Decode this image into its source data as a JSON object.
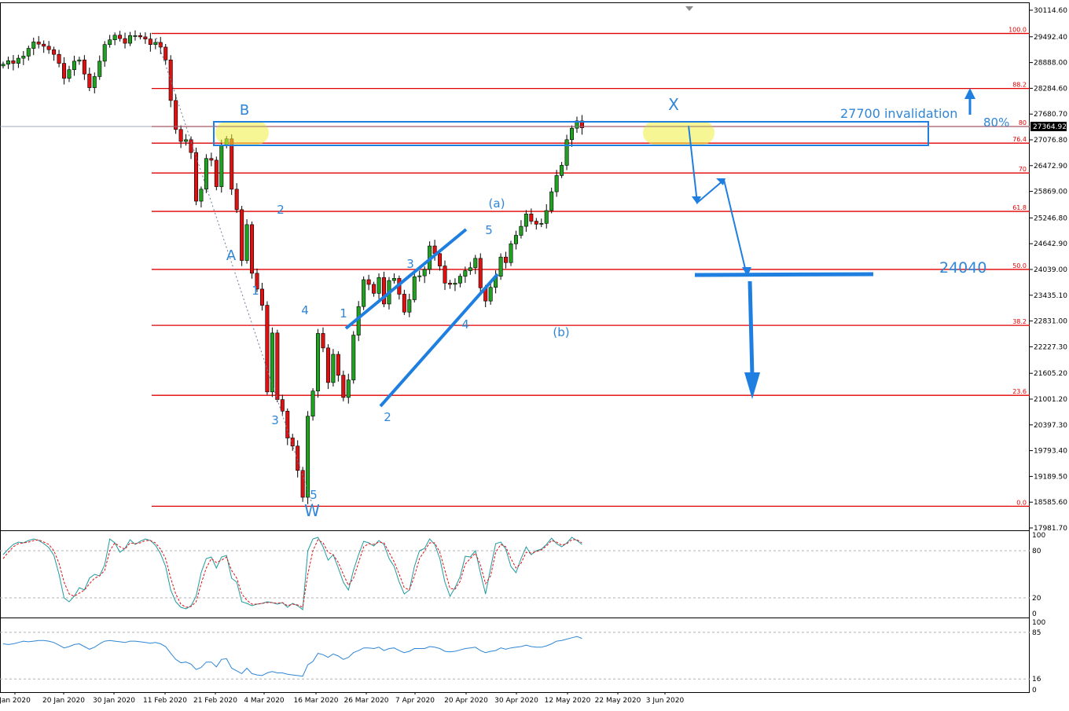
{
  "chart_data": [
    {
      "type": "candlestick",
      "title": "",
      "x_tick_labels": [
        "Jan 2020",
        "20 Jan 2020",
        "30 Jan 2020",
        "11 Feb 2020",
        "21 Feb 2020",
        "4 Mar 2020",
        "16 Mar 2020",
        "26 Mar 2020",
        "7 Apr 2020",
        "20 Apr 2020",
        "30 Apr 2020",
        "12 May 2020",
        "22 May 2020",
        "3 Jun 2020"
      ],
      "y_tick_labels": [
        "30114.60",
        "29492.40",
        "28888.00",
        "28284.60",
        "27680.70",
        "27076.80",
        "26472.90",
        "25869.00",
        "25246.80",
        "24642.90",
        "24039.00",
        "23435.10",
        "22831.00",
        "22227.30",
        "21605.20",
        "21001.20",
        "20397.30",
        "19793.40",
        "19189.50",
        "18585.60",
        "17981.70"
      ],
      "ylim": [
        17981.7,
        30114.6
      ],
      "current_price": "27364.92",
      "closes": [
        28850,
        28930,
        28870,
        28990,
        29040,
        29220,
        29370,
        29320,
        29270,
        29190,
        29080,
        28870,
        28520,
        28720,
        28920,
        28950,
        28620,
        28300,
        28560,
        28920,
        29310,
        29420,
        29530,
        29450,
        29340,
        29520,
        29520,
        29490,
        29440,
        29310,
        29360,
        29250,
        28950,
        28000,
        27320,
        27040,
        27080,
        26780,
        25640,
        25920,
        26640,
        26600,
        25980,
        26960,
        27100,
        25920,
        25440,
        24250,
        25090,
        23950,
        23580,
        23200,
        21170,
        22550,
        20990,
        20720,
        20090,
        19900,
        19330,
        18700,
        20600,
        21190,
        22540,
        22200,
        21390,
        22050,
        21560,
        21040,
        21450,
        22500,
        23170,
        23800,
        23690,
        23480,
        23850,
        23230,
        23780,
        23830,
        23460,
        23040,
        23330,
        23870,
        23890,
        24040,
        24590,
        24410,
        24120,
        23720,
        23690,
        23720,
        23880,
        24010,
        24080,
        24300,
        23610,
        23300,
        23620,
        23880,
        24330,
        24200,
        24640,
        24840,
        25050,
        25340,
        25170,
        25100,
        25120,
        25420,
        25860,
        26240,
        26480,
        27080,
        27350,
        27520,
        27360
      ],
      "fibonacci_levels": [
        {
          "label": "100.0",
          "value": 29570
        },
        {
          "label": "88.2",
          "value": 28280
        },
        {
          "label": "80",
          "value": 27390
        },
        {
          "label": "76.4",
          "value": 27000
        },
        {
          "label": "70",
          "value": 26300
        },
        {
          "label": "61.8",
          "value": 25400
        },
        {
          "label": "50.0",
          "value": 24040
        },
        {
          "label": "38.2",
          "value": 22730
        },
        {
          "label": "23.6",
          "value": 21090
        },
        {
          "label": "0.0",
          "value": 18490
        }
      ],
      "annotations": [
        {
          "label": "B"
        },
        {
          "label": "A"
        },
        {
          "label": "1"
        },
        {
          "label": "2"
        },
        {
          "label": "3"
        },
        {
          "label": "4"
        },
        {
          "label": "5"
        },
        {
          "label": "W"
        },
        {
          "label": "1"
        },
        {
          "label": "2"
        },
        {
          "label": "3"
        },
        {
          "label": "4"
        },
        {
          "label": "5"
        },
        {
          "label": "(a)"
        },
        {
          "label": "(b)"
        },
        {
          "label": "X"
        }
      ],
      "invalidation_text": "27700 invalidation",
      "target_text": "24040",
      "pct_text": "80%"
    },
    {
      "type": "line",
      "title": "",
      "y_tick_labels": [
        "100",
        "80",
        "20",
        "0"
      ],
      "ylim": [
        0,
        100
      ],
      "reference_levels": [
        80,
        20
      ],
      "series": [
        {
          "values": [
            75,
            82,
            88,
            91,
            90,
            93,
            95,
            93,
            89,
            84,
            74,
            50,
            20,
            15,
            22,
            33,
            30,
            45,
            50,
            48,
            62,
            95,
            90,
            78,
            83,
            94,
            88,
            92,
            95,
            93,
            87,
            76,
            60,
            30,
            15,
            8,
            6,
            10,
            22,
            52,
            70,
            72,
            58,
            72,
            74,
            45,
            40,
            15,
            13,
            10,
            12,
            13,
            15,
            14,
            12,
            14,
            8,
            13,
            10,
            5,
            80,
            95,
            97,
            85,
            68,
            75,
            58,
            40,
            30,
            55,
            75,
            92,
            90,
            86,
            93,
            88,
            70,
            60,
            40,
            25,
            30,
            60,
            80,
            83,
            95,
            88,
            70,
            40,
            22,
            33,
            47,
            73,
            72,
            80,
            52,
            25,
            58,
            89,
            91,
            82,
            60,
            52,
            70,
            85,
            75,
            80,
            82,
            88,
            96,
            89,
            85,
            90,
            97,
            93,
            88
          ]
        },
        {
          "values": [
            70,
            78,
            85,
            89,
            90,
            91,
            93,
            94,
            91,
            88,
            80,
            64,
            40,
            25,
            22,
            26,
            30,
            38,
            45,
            48,
            55,
            80,
            90,
            85,
            82,
            90,
            89,
            90,
            93,
            93,
            90,
            82,
            70,
            45,
            25,
            12,
            8,
            9,
            15,
            38,
            58,
            70,
            65,
            68,
            72,
            55,
            45,
            25,
            17,
            12,
            12,
            13,
            14,
            14,
            13,
            14,
            10,
            12,
            11,
            8,
            50,
            80,
            94,
            90,
            78,
            75,
            65,
            50,
            36,
            45,
            65,
            85,
            89,
            88,
            91,
            90,
            78,
            66,
            50,
            33,
            30,
            48,
            70,
            80,
            90,
            90,
            78,
            55,
            32,
            31,
            41,
            63,
            70,
            77,
            62,
            38,
            48,
            78,
            88,
            85,
            70,
            58,
            64,
            78,
            77,
            79,
            81,
            86,
            93,
            91,
            87,
            89,
            94,
            94,
            90
          ]
        }
      ]
    },
    {
      "type": "line",
      "title": "",
      "y_tick_labels": [
        "100",
        "85",
        "16",
        "0"
      ],
      "ylim": [
        0,
        100
      ],
      "reference_levels": [
        85,
        16
      ],
      "series": [
        {
          "values": [
            68,
            67,
            68,
            70,
            72,
            71,
            72,
            73,
            73,
            72,
            70,
            66,
            62,
            64,
            67,
            68,
            64,
            60,
            63,
            68,
            72,
            73,
            72,
            71,
            70,
            72,
            72,
            71,
            70,
            69,
            70,
            68,
            64,
            54,
            45,
            40,
            41,
            38,
            30,
            33,
            41,
            41,
            34,
            45,
            46,
            32,
            28,
            24,
            32,
            24,
            22,
            21,
            25,
            27,
            25,
            25,
            23,
            22,
            21,
            20,
            37,
            42,
            54,
            52,
            48,
            53,
            50,
            45,
            48,
            55,
            58,
            62,
            62,
            61,
            63,
            58,
            61,
            62,
            58,
            55,
            57,
            61,
            61,
            61,
            64,
            63,
            61,
            57,
            56,
            57,
            59,
            61,
            62,
            63,
            58,
            55,
            57,
            58,
            62,
            60,
            62,
            63,
            64,
            66,
            64,
            63,
            63,
            65,
            68,
            72,
            73,
            75,
            77,
            79,
            76
          ]
        }
      ]
    }
  ]
}
